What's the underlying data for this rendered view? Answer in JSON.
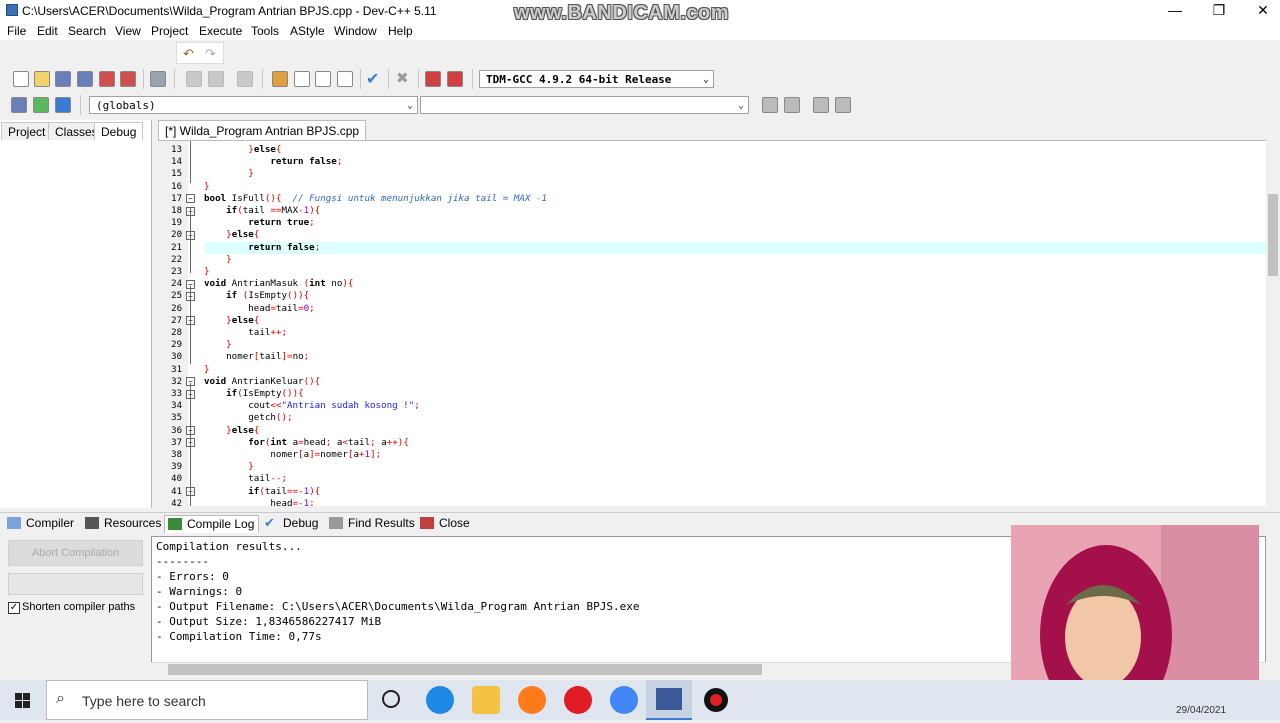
{
  "window": {
    "title": "C:\\Users\\ACER\\Documents\\Wilda_Program Antrian BPJS.cpp - Dev-C++ 5.11",
    "watermark": "www.BANDICAM.com",
    "controls": {
      "minimize": "—",
      "maximize": "❐",
      "close": "✕"
    }
  },
  "menu": [
    "File",
    "Edit",
    "Search",
    "View",
    "Project",
    "Execute",
    "Tools",
    "AStyle",
    "Window",
    "Help"
  ],
  "toolbar": {
    "compiler_select": "TDM-GCC 4.9.2 64-bit Release",
    "scope_select": "(globals)",
    "function_select": ""
  },
  "left_panel": {
    "tabs": [
      "Project",
      "Classes",
      "Debug"
    ],
    "active_tab": "Debug"
  },
  "editor": {
    "file_tab": "[*] Wilda_Program Antrian BPJS.cpp",
    "lines": [
      {
        "n": "13",
        "segs": [
          [
            "        ",
            ""
          ],
          [
            "}",
            "sym"
          ],
          [
            "else",
            "kw"
          ],
          [
            "{",
            "sym"
          ]
        ]
      },
      {
        "n": "14",
        "segs": [
          [
            "            ",
            ""
          ],
          [
            "return",
            "kw"
          ],
          [
            " ",
            ""
          ],
          [
            "false",
            "kw"
          ],
          [
            ";",
            "sym"
          ]
        ]
      },
      {
        "n": "15",
        "segs": [
          [
            "        ",
            ""
          ],
          [
            "}",
            "sym"
          ]
        ]
      },
      {
        "n": "16",
        "segs": [
          [
            "}",
            "sym"
          ]
        ]
      },
      {
        "n": "17",
        "segs": [
          [
            "bool",
            "kw"
          ],
          [
            " IsFull",
            ""
          ],
          [
            "(){",
            "sym"
          ],
          [
            "  // Fungsi untuk menunjukkan jika tail = MAX -1",
            "cm"
          ]
        ]
      },
      {
        "n": "18",
        "segs": [
          [
            "    ",
            ""
          ],
          [
            "if",
            "kw"
          ],
          [
            "(",
            "sym"
          ],
          [
            "tail ",
            ""
          ],
          [
            "==",
            "sym"
          ],
          [
            "MAX",
            ""
          ],
          [
            "-",
            "sym"
          ],
          [
            "1",
            "num"
          ],
          [
            "){",
            "sym"
          ]
        ]
      },
      {
        "n": "19",
        "segs": [
          [
            "        ",
            ""
          ],
          [
            "return",
            "kw"
          ],
          [
            " ",
            ""
          ],
          [
            "true",
            "kw"
          ],
          [
            ";",
            "sym"
          ]
        ]
      },
      {
        "n": "20",
        "segs": [
          [
            "    ",
            ""
          ],
          [
            "}",
            "sym"
          ],
          [
            "else",
            "kw"
          ],
          [
            "{",
            "sym"
          ]
        ]
      },
      {
        "n": "21",
        "segs": [
          [
            "        ",
            ""
          ],
          [
            "return",
            "kw"
          ],
          [
            " ",
            ""
          ],
          [
            "false",
            "kw"
          ],
          [
            ";",
            "sym"
          ]
        ]
      },
      {
        "n": "22",
        "segs": [
          [
            "    ",
            ""
          ],
          [
            "}",
            "sym"
          ]
        ]
      },
      {
        "n": "23",
        "segs": [
          [
            "}",
            "sym"
          ]
        ]
      },
      {
        "n": "24",
        "segs": [
          [
            "void",
            "kw"
          ],
          [
            " AntrianMasuk ",
            ""
          ],
          [
            "(",
            "sym"
          ],
          [
            "int",
            "kw"
          ],
          [
            " no",
            ""
          ],
          [
            "){",
            "sym"
          ]
        ]
      },
      {
        "n": "25",
        "segs": [
          [
            "    ",
            ""
          ],
          [
            "if",
            "kw"
          ],
          [
            " ",
            ""
          ],
          [
            "(",
            "sym"
          ],
          [
            "IsEmpty",
            ""
          ],
          [
            "()){",
            "sym"
          ]
        ]
      },
      {
        "n": "26",
        "segs": [
          [
            "        head",
            ""
          ],
          [
            "=",
            "sym"
          ],
          [
            "tail",
            ""
          ],
          [
            "=",
            "sym"
          ],
          [
            "0",
            "num"
          ],
          [
            ";",
            "sym"
          ]
        ]
      },
      {
        "n": "27",
        "segs": [
          [
            "    ",
            ""
          ],
          [
            "}",
            "sym"
          ],
          [
            "else",
            "kw"
          ],
          [
            "{",
            "sym"
          ]
        ]
      },
      {
        "n": "28",
        "segs": [
          [
            "        tail",
            ""
          ],
          [
            "++;",
            "sym"
          ]
        ]
      },
      {
        "n": "29",
        "segs": [
          [
            "    ",
            ""
          ],
          [
            "}",
            "sym"
          ]
        ]
      },
      {
        "n": "30",
        "segs": [
          [
            "    nomer",
            ""
          ],
          [
            "[",
            "sym"
          ],
          [
            "tail",
            ""
          ],
          [
            "]=",
            "sym"
          ],
          [
            "no",
            ""
          ],
          [
            ";",
            "sym"
          ]
        ]
      },
      {
        "n": "31",
        "segs": [
          [
            "}",
            "sym"
          ]
        ]
      },
      {
        "n": "32",
        "segs": [
          [
            "void",
            "kw"
          ],
          [
            " AntrianKeluar",
            ""
          ],
          [
            "(){",
            "sym"
          ]
        ]
      },
      {
        "n": "33",
        "segs": [
          [
            "    ",
            ""
          ],
          [
            "if",
            "kw"
          ],
          [
            "(",
            "sym"
          ],
          [
            "IsEmpty",
            ""
          ],
          [
            "()){",
            "sym"
          ]
        ]
      },
      {
        "n": "34",
        "segs": [
          [
            "        cout",
            ""
          ],
          [
            "<<",
            "sym"
          ],
          [
            "\"Antrian sudah kosong !\"",
            "st"
          ],
          [
            ";",
            "sym"
          ]
        ]
      },
      {
        "n": "35",
        "segs": [
          [
            "        getch",
            ""
          ],
          [
            "();",
            "sym"
          ]
        ]
      },
      {
        "n": "36",
        "segs": [
          [
            "    ",
            ""
          ],
          [
            "}",
            "sym"
          ],
          [
            "else",
            "kw"
          ],
          [
            "{",
            "sym"
          ]
        ]
      },
      {
        "n": "37",
        "segs": [
          [
            "        ",
            ""
          ],
          [
            "for",
            "kw"
          ],
          [
            "(",
            "sym"
          ],
          [
            "int",
            "kw"
          ],
          [
            " a",
            ""
          ],
          [
            "=",
            "sym"
          ],
          [
            "head",
            ""
          ],
          [
            "; ",
            "sym"
          ],
          [
            "a",
            ""
          ],
          [
            "<",
            "sym"
          ],
          [
            "tail",
            ""
          ],
          [
            "; ",
            "sym"
          ],
          [
            "a",
            ""
          ],
          [
            "++){",
            "sym"
          ]
        ]
      },
      {
        "n": "38",
        "segs": [
          [
            "            nomer",
            ""
          ],
          [
            "[",
            "sym"
          ],
          [
            "a",
            ""
          ],
          [
            "]=",
            "sym"
          ],
          [
            "nomer",
            ""
          ],
          [
            "[",
            "sym"
          ],
          [
            "a",
            ""
          ],
          [
            "+",
            "sym"
          ],
          [
            "1",
            "num"
          ],
          [
            "];",
            "sym"
          ]
        ]
      },
      {
        "n": "39",
        "segs": [
          [
            "        ",
            ""
          ],
          [
            "}",
            "sym"
          ]
        ]
      },
      {
        "n": "40",
        "segs": [
          [
            "        tail",
            ""
          ],
          [
            "--;",
            "sym"
          ]
        ]
      },
      {
        "n": "41",
        "segs": [
          [
            "        ",
            ""
          ],
          [
            "if",
            "kw"
          ],
          [
            "(",
            "sym"
          ],
          [
            "tail",
            ""
          ],
          [
            "==-",
            "sym"
          ],
          [
            "1",
            "num"
          ],
          [
            "){",
            "sym"
          ]
        ]
      },
      {
        "n": "42",
        "segs": [
          [
            "            head",
            ""
          ],
          [
            "=-",
            "sym"
          ],
          [
            "1",
            "num"
          ],
          [
            ";",
            "sym"
          ]
        ]
      }
    ]
  },
  "bottom_tabs": [
    "Compiler",
    "Resources",
    "Compile Log",
    "Debug",
    "Find Results",
    "Close"
  ],
  "bottom_active_tab": "Compile Log",
  "compile_panel": {
    "abort_button": "Abort Compilation",
    "shorten_paths_label": "Shorten compiler paths",
    "shorten_paths_checked": "✓"
  },
  "compile_log": [
    "Compilation results...",
    "--------",
    "- Errors: 0",
    "- Warnings: 0",
    "- Output Filename: C:\\Users\\ACER\\Documents\\Wilda_Program Antrian BPJS.exe",
    "- Output Size: 1,8346586227417 MiB",
    "- Compilation Time: 0,77s"
  ],
  "taskbar": {
    "search_placeholder": "Type here to search",
    "date": "29/04/2021"
  }
}
